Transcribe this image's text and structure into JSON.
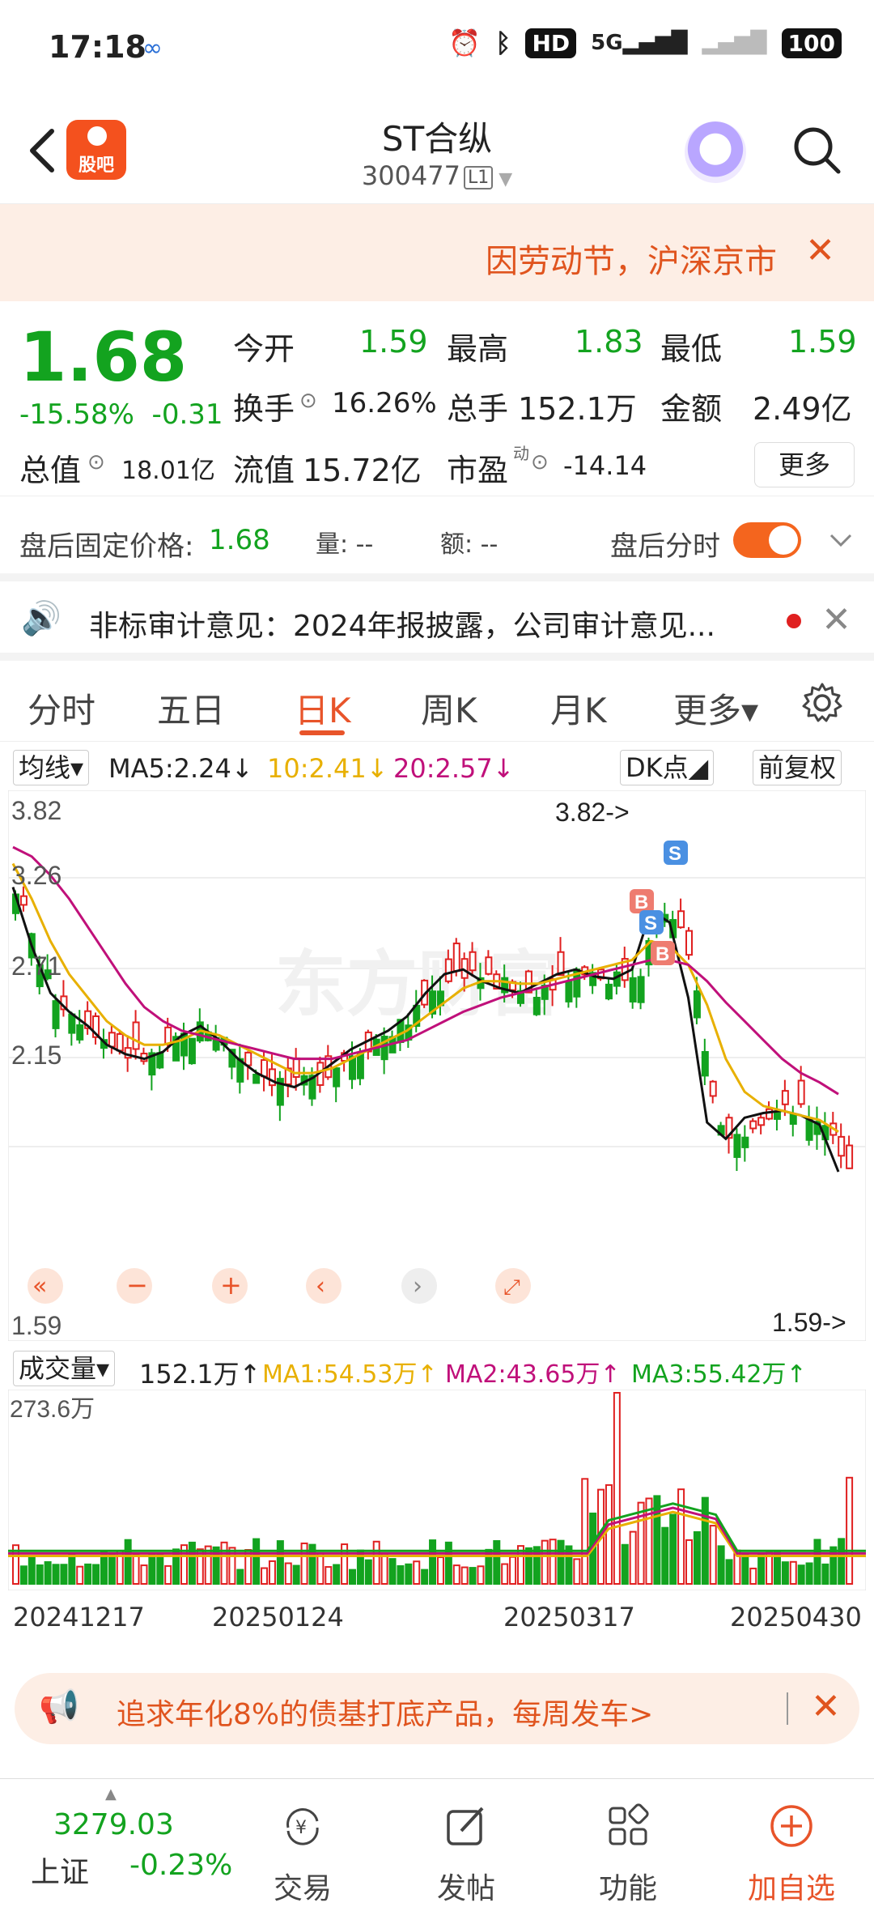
{
  "status": {
    "time": "17:18",
    "hd": "HD",
    "net": "5G",
    "battery": "100"
  },
  "header": {
    "title": "ST合纵",
    "code": "300477",
    "level": "L1",
    "guba_label": "股吧"
  },
  "notice": {
    "text": "因劳动节，沪深京市",
    "close": "✕"
  },
  "quote": {
    "price": "1.68",
    "change_pct": "-15.58%",
    "change": "-0.31",
    "open_label": "今开",
    "open": "1.59",
    "high_label": "最高",
    "high": "1.83",
    "low_label": "最低",
    "low": "1.59",
    "turnover_label": "换手",
    "turnover": "16.26%",
    "volume_label": "总手",
    "volume": "152.1万",
    "amount_label": "金额",
    "amount": "2.49亿",
    "mktcap_label": "总值",
    "mktcap": "18.01亿",
    "float_label": "流值",
    "float": "15.72亿",
    "pe_label": "市盈",
    "pe_sup": "动",
    "pe": "-14.14",
    "more": "更多"
  },
  "after_hours": {
    "price_label": "盘后固定价格:",
    "price": "1.68",
    "vol": "量: --",
    "amt": "额: --",
    "toggle_label": "盘后分时"
  },
  "news": {
    "text": "非标审计意见：2024年报披露，公司审计意见..."
  },
  "tabs": [
    "分时",
    "五日",
    "日K",
    "周K",
    "月K",
    "更多▾"
  ],
  "ma_legend": {
    "select": "均线▾",
    "ma5": "MA5:2.24↓",
    "ma10": "10:2.41↓",
    "ma20": "20:2.57↓",
    "dk": "DK点◢",
    "adjust": "前复权"
  },
  "kline_labels": {
    "y_top": "3.82",
    "y_2": "3.26",
    "y_3": "2.71",
    "y_4": "2.15",
    "y_bottom": "1.59",
    "high_marker": "3.82->",
    "low_marker": "1.59->",
    "watermark": "东方财富"
  },
  "vol_legend": {
    "select": "成交量▾",
    "vol": "152.1万↑",
    "ma1": "MA1:54.53万↑",
    "ma2": "MA2:43.65万↑",
    "ma3": "MA3:55.42万↑",
    "y_top": "273.6万"
  },
  "dates": [
    "20241217",
    "20250124",
    "20250317",
    "20250430"
  ],
  "ad": {
    "text": "追求年化8%的债基打底产品，每周发车>"
  },
  "bottom": {
    "index_value": "3279.03",
    "index_name": "上证",
    "index_change": "-0.23%",
    "nav": [
      "交易",
      "发帖",
      "功能",
      "加自选"
    ]
  },
  "colors": {
    "up": "#e02020",
    "down": "#13a31f",
    "accent": "#e8542a",
    "ma5": "#111111",
    "ma10": "#e8b000",
    "ma20": "#c0107a"
  },
  "chart_data": {
    "type": "candlestick",
    "ylim": [
      1.59,
      3.82
    ],
    "ma_lines": {
      "MA5": [
        3.45,
        3.2,
        3.0,
        2.92,
        2.86,
        2.78,
        2.74,
        2.72,
        2.75,
        2.82,
        2.86,
        2.8,
        2.72,
        2.66,
        2.62,
        2.6,
        2.64,
        2.7,
        2.76,
        2.8,
        2.84,
        2.9,
        3.0,
        3.08,
        3.1,
        3.05,
        3.02,
        3.0,
        3.04,
        3.08,
        3.1,
        3.07,
        3.06,
        3.1,
        3.35,
        3.3,
        2.98,
        2.45,
        2.38,
        2.47,
        2.49,
        2.5,
        2.48,
        2.44,
        2.24
      ],
      "MA10": [
        3.55,
        3.4,
        3.22,
        3.08,
        2.98,
        2.88,
        2.82,
        2.78,
        2.78,
        2.8,
        2.84,
        2.82,
        2.78,
        2.74,
        2.7,
        2.66,
        2.66,
        2.68,
        2.72,
        2.76,
        2.8,
        2.84,
        2.9,
        2.96,
        3.02,
        3.05,
        3.05,
        3.04,
        3.04,
        3.06,
        3.08,
        3.1,
        3.12,
        3.14,
        3.22,
        3.2,
        3.12,
        2.95,
        2.72,
        2.58,
        2.52,
        2.5,
        2.48,
        2.46,
        2.41
      ],
      "MA20": [
        3.62,
        3.58,
        3.5,
        3.4,
        3.28,
        3.16,
        3.04,
        2.94,
        2.88,
        2.84,
        2.82,
        2.8,
        2.78,
        2.76,
        2.74,
        2.72,
        2.72,
        2.72,
        2.74,
        2.76,
        2.78,
        2.8,
        2.84,
        2.88,
        2.92,
        2.95,
        2.98,
        3.0,
        3.02,
        3.04,
        3.06,
        3.08,
        3.1,
        3.12,
        3.14,
        3.14,
        3.12,
        3.05,
        2.96,
        2.88,
        2.8,
        2.72,
        2.66,
        2.62,
        2.57
      ]
    },
    "volume": {
      "ylim": [
        0,
        273.6
      ],
      "last": 152.1,
      "max_marker": 273.6
    }
  }
}
